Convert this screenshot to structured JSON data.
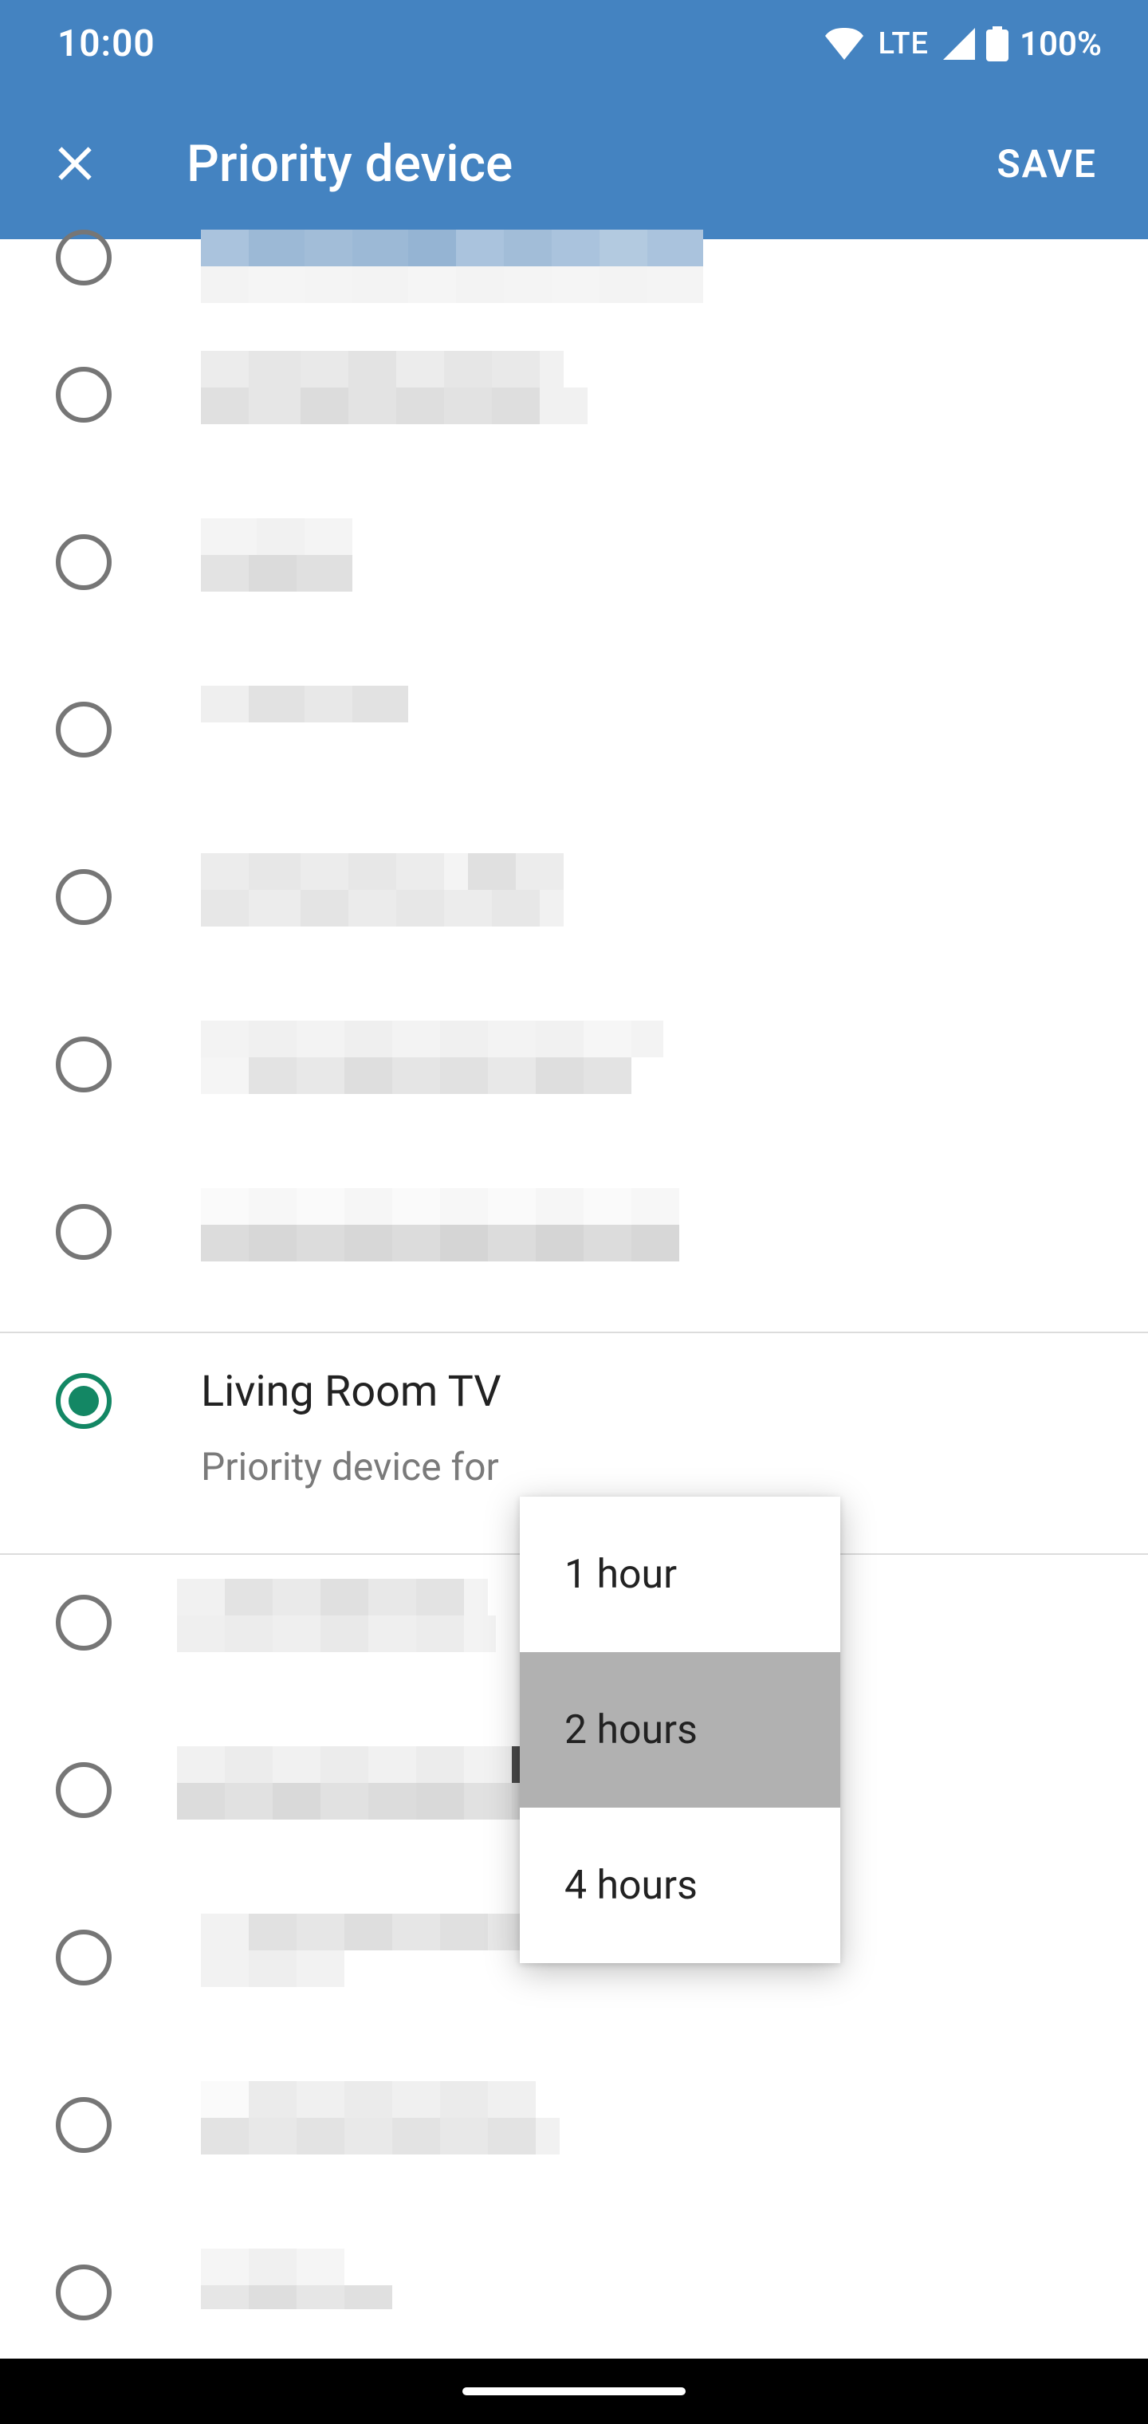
{
  "status": {
    "time": "10:00",
    "network": "LTE",
    "battery": "100%"
  },
  "header": {
    "title": "Priority device",
    "save": "SAVE"
  },
  "selected": {
    "label": "Living Room TV",
    "sub": "Priority device for"
  },
  "dropdown": {
    "opt1": "1 hour",
    "opt2": "2 hours",
    "opt3": "4 hours"
  }
}
